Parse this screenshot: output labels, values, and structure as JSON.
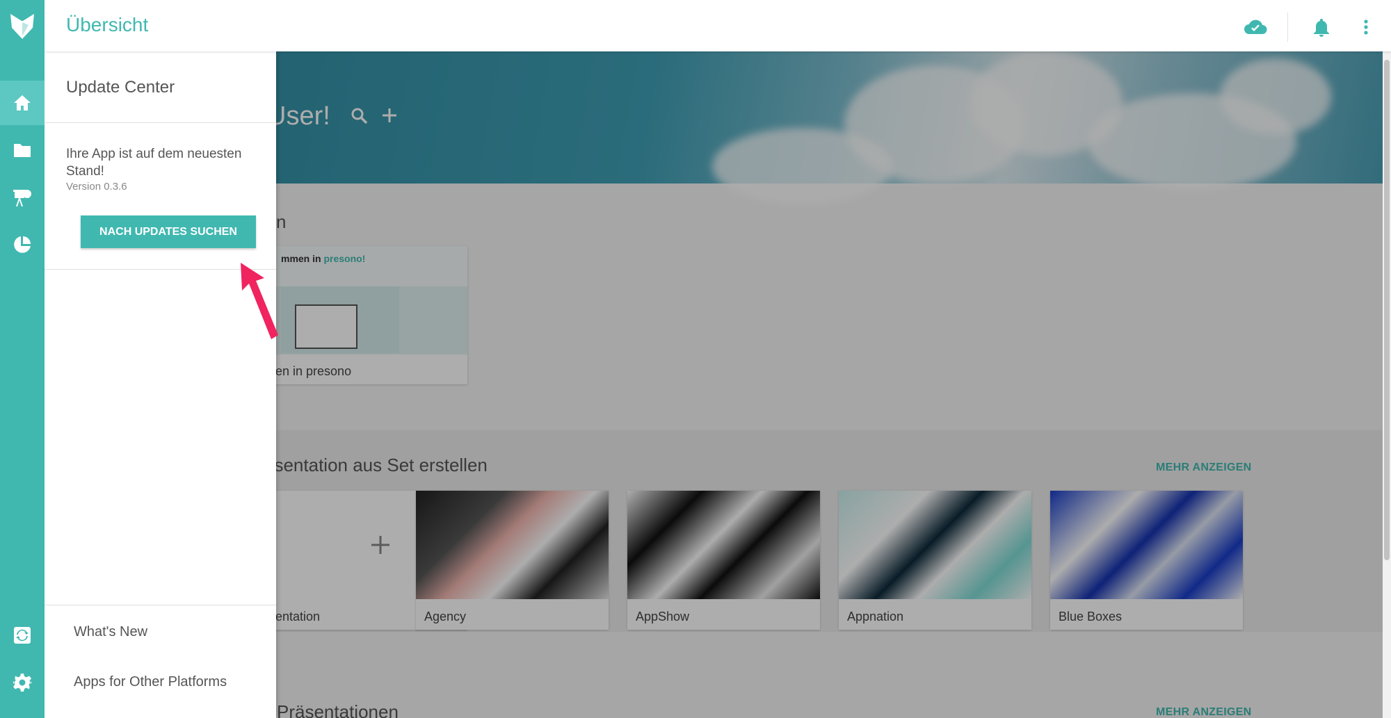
{
  "topbar": {
    "title": "Übersicht",
    "icons": [
      "cloud-check-icon",
      "bell-icon",
      "more-vert-icon"
    ]
  },
  "rail": {
    "items": [
      "home-icon",
      "folder-icon",
      "presentation-icon",
      "pie-chart-icon",
      "sync-icon",
      "settings-icon"
    ]
  },
  "hero": {
    "greeting": "User!"
  },
  "recent": {
    "title": "n",
    "card_label": "en in presono",
    "thumb_heading": "mmen in ",
    "thumb_brand": "presono!"
  },
  "sets": {
    "title": "äsentation aus Set erstellen",
    "more": "MEHR ANZEIGEN",
    "cards": [
      {
        "label": "entation"
      },
      {
        "label": "Agency"
      },
      {
        "label": "AppShow"
      },
      {
        "label": "Appnation"
      },
      {
        "label": "Blue Boxes"
      }
    ]
  },
  "presentations": {
    "title": "Präsentationen",
    "more": "MEHR ANZEIGEN"
  },
  "drawer": {
    "title": "Update Center",
    "status": "Ihre App ist auf dem neuesten Stand!",
    "version": "Version 0.3.6",
    "button": "NACH UPDATES SUCHEN",
    "links": [
      "What's New",
      "Apps for Other Platforms"
    ]
  },
  "colors": {
    "accent": "#40b8b0",
    "annotation_arrow": "#f0245f"
  }
}
